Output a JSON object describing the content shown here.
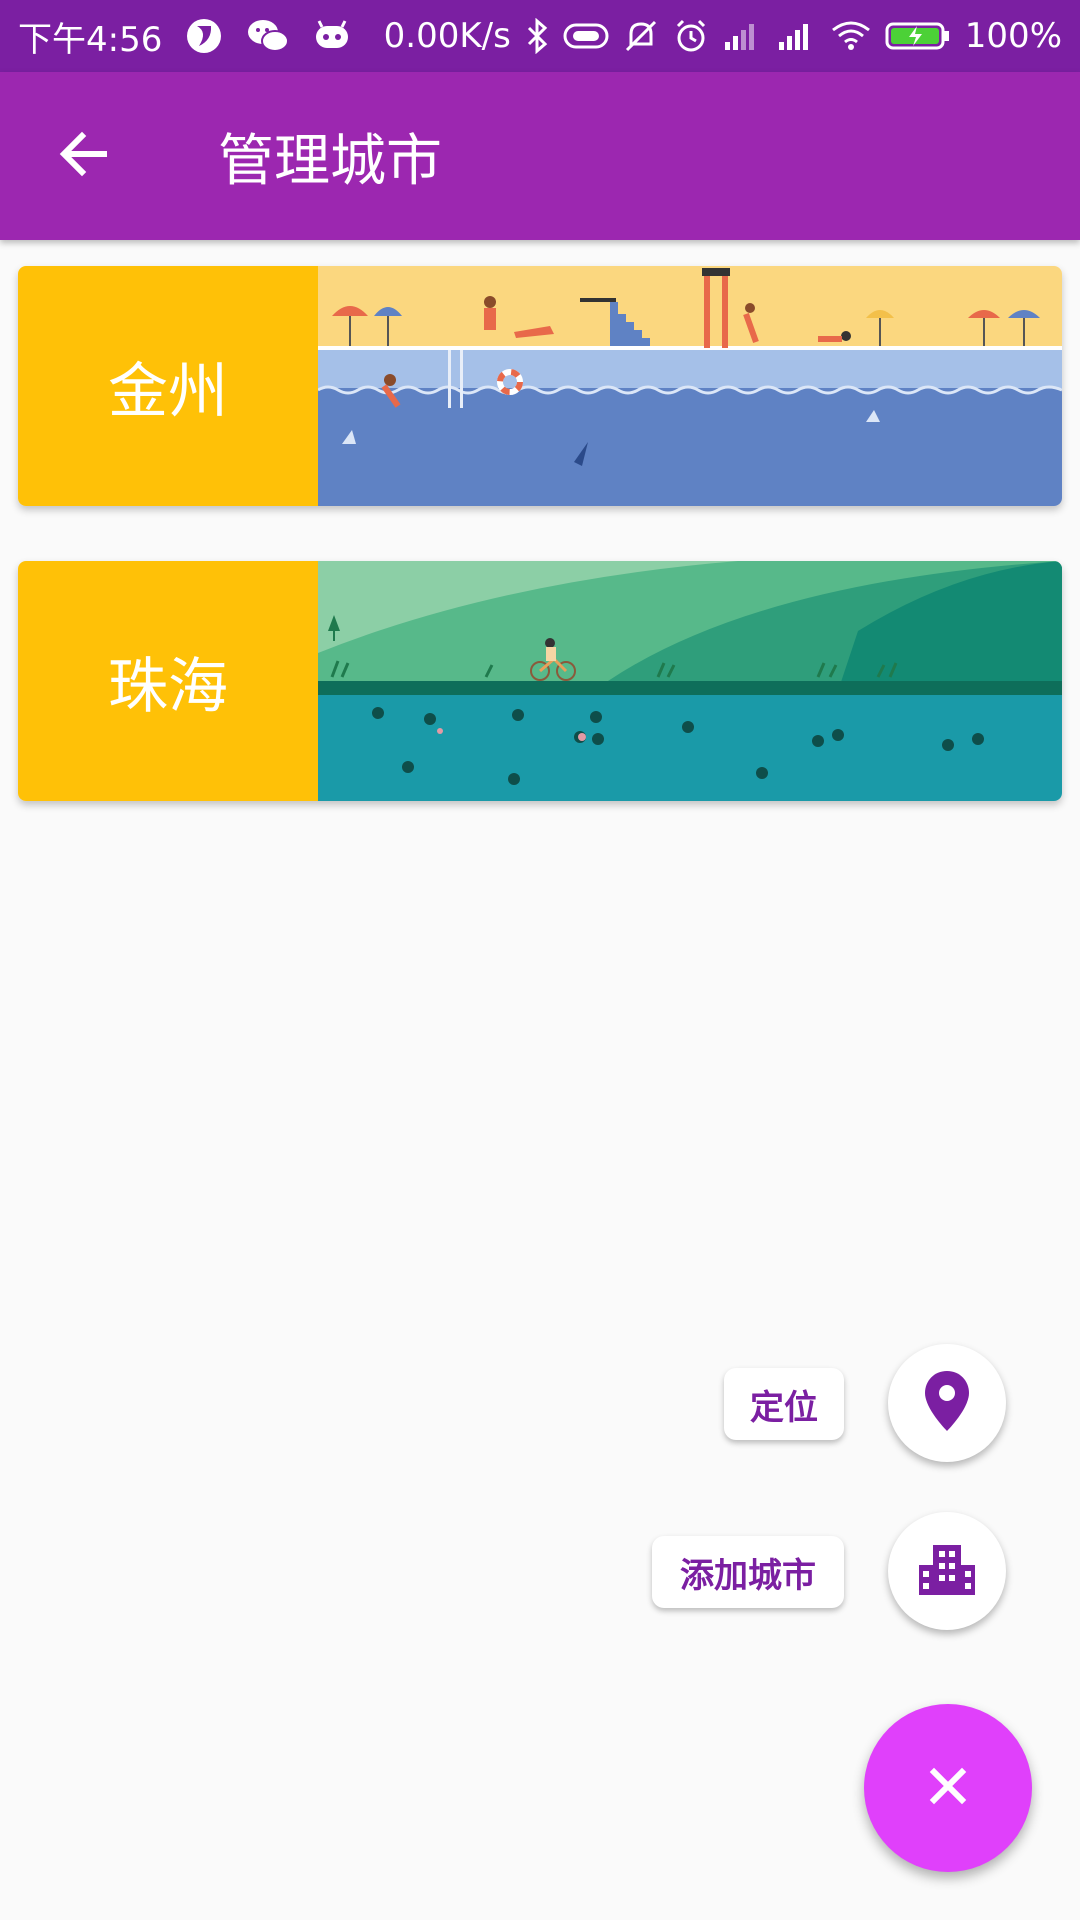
{
  "status_bar": {
    "time": "下午4:56",
    "net_speed": "0.00K/s",
    "battery": "100%"
  },
  "app_bar": {
    "title": "管理城市"
  },
  "cities": [
    {
      "name": "金州",
      "scene": "beach"
    },
    {
      "name": "珠海",
      "scene": "hills"
    }
  ],
  "speed_dial": {
    "locate_label": "定位",
    "add_city_label": "添加城市"
  },
  "colors": {
    "status_bar": "#7b1fa2",
    "app_bar": "#9c27b0",
    "card_label": "#ffc107",
    "fab": "#e040fb",
    "accent": "#7b1fa2"
  }
}
